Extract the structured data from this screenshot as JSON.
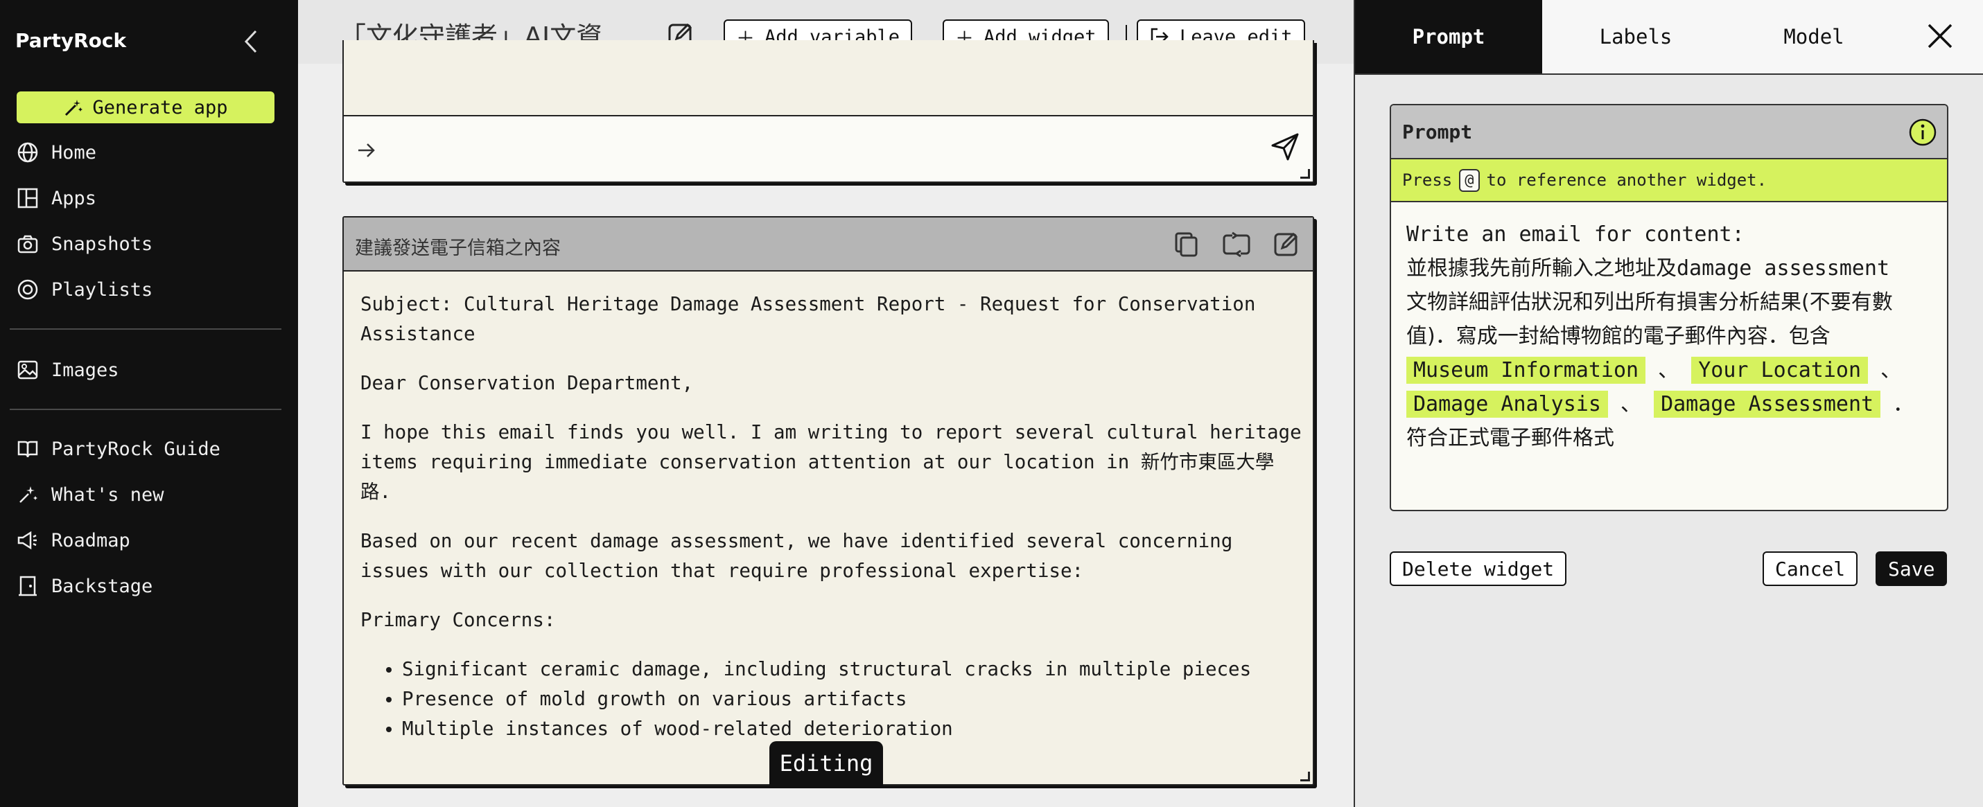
{
  "sidebar": {
    "brand": "PartyRock",
    "generate_label": "Generate app",
    "items": [
      {
        "label": "Home",
        "icon": "globe-icon"
      },
      {
        "label": "Apps",
        "icon": "apps-icon"
      },
      {
        "label": "Snapshots",
        "icon": "camera-icon"
      },
      {
        "label": "Playlists",
        "icon": "playlist-icon"
      },
      {
        "label": "Images",
        "icon": "images-icon"
      },
      {
        "label": "PartyRock Guide",
        "icon": "book-icon"
      },
      {
        "label": "What's new",
        "icon": "sparkle-icon"
      },
      {
        "label": "Roadmap",
        "icon": "megaphone-icon"
      },
      {
        "label": "Backstage",
        "icon": "backstage-icon"
      }
    ]
  },
  "topbar": {
    "title": "「文化守護者」AI文資...",
    "add_variable": "Add variable",
    "add_widget": "Add widget",
    "leave_edit": "Leave edit"
  },
  "email_widget": {
    "title": "建議發送電子信箱之內容",
    "subject": "Subject: Cultural Heritage Damage Assessment Report - Request for Conservation Assistance",
    "greeting": "Dear Conservation Department,",
    "para1": "I hope this email finds you well. I am writing to report several cultural heritage items requiring immediate conservation attention at our location in 新竹市東區大學路.",
    "para2": "Based on our recent damage assessment, we have identified several concerning issues with our collection that require professional expertise:",
    "concerns_heading": "Primary Concerns:",
    "concerns": [
      "Significant ceramic damage, including structural cracks in multiple pieces",
      "Presence of mold growth on various artifacts",
      "Multiple instances of wood-related deterioration"
    ],
    "editing_badge": "Editing"
  },
  "panel": {
    "tabs": [
      "Prompt",
      "Labels",
      "Model"
    ],
    "active_tab": "Prompt",
    "prompt_title": "Prompt",
    "hint_before": "Press",
    "hint_key": "@",
    "hint_after": "to reference another widget.",
    "prompt_line1": "Write an email for content:",
    "prompt_line2": "並根據我先前所輸入之地址及",
    "prompt_line2_en": "damage assessment",
    "prompt_line3": "文物詳細評估狀況和列出所有損害分析結果(不要有數值)．寫成一封給博物館的電子郵件內容．包含",
    "refs": [
      "Museum Information",
      "Your Location",
      "Damage Analysis",
      "Damage Assessment"
    ],
    "sep1": "、",
    "sep2": "、",
    "sep3": "、",
    "prompt_tail": "．符合正式電子郵件格式",
    "delete_label": "Delete widget",
    "cancel_label": "Cancel",
    "save_label": "Save"
  },
  "colors": {
    "accent": "#d6f25e",
    "sidebar_bg": "#111111",
    "widget_bg": "#f3f1e6"
  }
}
